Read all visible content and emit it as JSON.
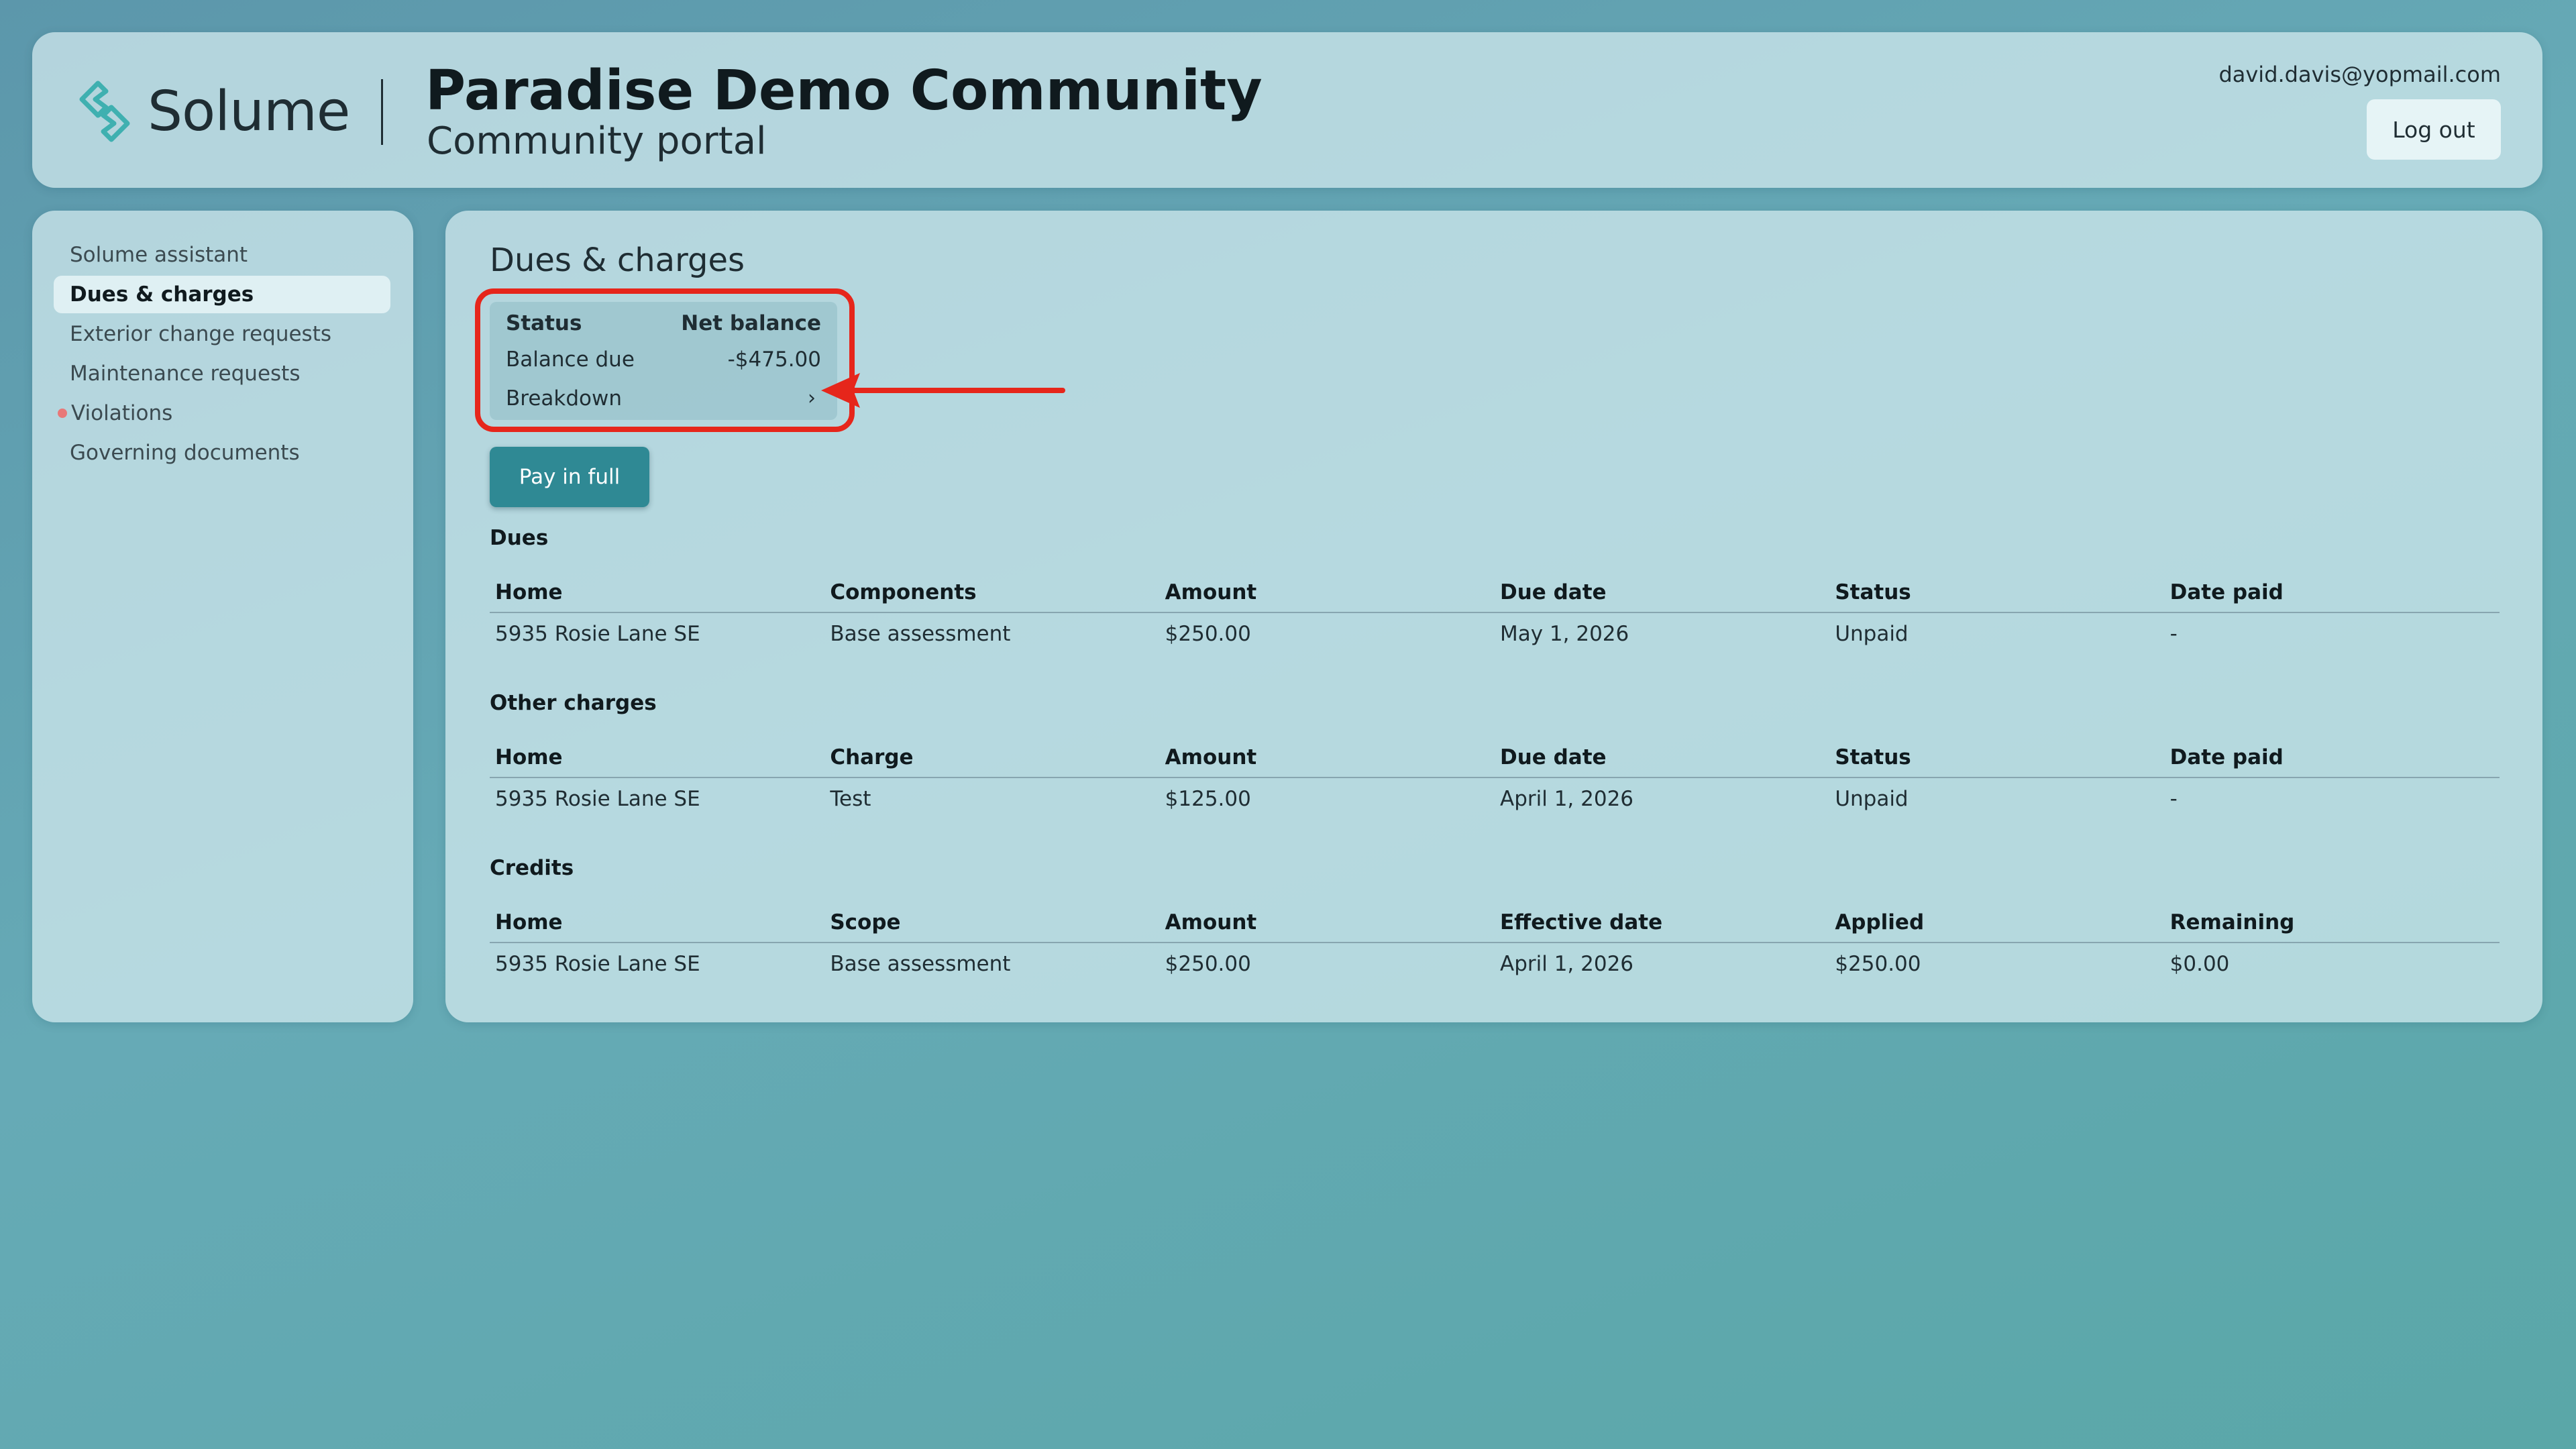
{
  "header": {
    "brand": "Solume",
    "community_name": "Paradise Demo Community",
    "portal_label": "Community portal",
    "user_email": "david.davis@yopmail.com",
    "logout_label": "Log out"
  },
  "sidebar": {
    "items": [
      {
        "label": "Solume assistant",
        "active": false,
        "alert": false
      },
      {
        "label": "Dues & charges",
        "active": true,
        "alert": false
      },
      {
        "label": "Exterior change requests",
        "active": false,
        "alert": false
      },
      {
        "label": "Maintenance requests",
        "active": false,
        "alert": false
      },
      {
        "label": "Violations",
        "active": false,
        "alert": true
      },
      {
        "label": "Governing documents",
        "active": false,
        "alert": false
      }
    ]
  },
  "main": {
    "heading": "Dues & charges",
    "balance_card": {
      "status_label": "Status",
      "status_value": "Net balance",
      "balance_label": "Balance due",
      "balance_value": "-$475.00",
      "breakdown_label": "Breakdown",
      "breakdown_chevron": "›"
    },
    "pay_button_label": "Pay in full",
    "dues": {
      "title": "Dues",
      "columns": [
        "Home",
        "Components",
        "Amount",
        "Due date",
        "Status",
        "Date paid"
      ],
      "rows": [
        [
          "5935 Rosie Lane SE",
          "Base assessment",
          "$250.00",
          "May 1, 2026",
          "Unpaid",
          "-"
        ]
      ]
    },
    "other_charges": {
      "title": "Other charges",
      "columns": [
        "Home",
        "Charge",
        "Amount",
        "Due date",
        "Status",
        "Date paid"
      ],
      "rows": [
        [
          "5935 Rosie Lane SE",
          "Test",
          "$125.00",
          "April 1, 2026",
          "Unpaid",
          "-"
        ]
      ]
    },
    "credits": {
      "title": "Credits",
      "columns": [
        "Home",
        "Scope",
        "Amount",
        "Effective date",
        "Applied",
        "Remaining"
      ],
      "rows": [
        [
          "5935 Rosie Lane SE",
          "Base assessment",
          "$250.00",
          "April 1, 2026",
          "$250.00",
          "$0.00"
        ]
      ]
    }
  },
  "colors": {
    "accent": "#2f8994",
    "annotation": "#e6261b",
    "alert_dot": "#e87878"
  },
  "icons": {
    "logo": "solume-logo-icon",
    "breakdown": "chevron-right-icon",
    "annotation": "red-arrow-annotation"
  }
}
